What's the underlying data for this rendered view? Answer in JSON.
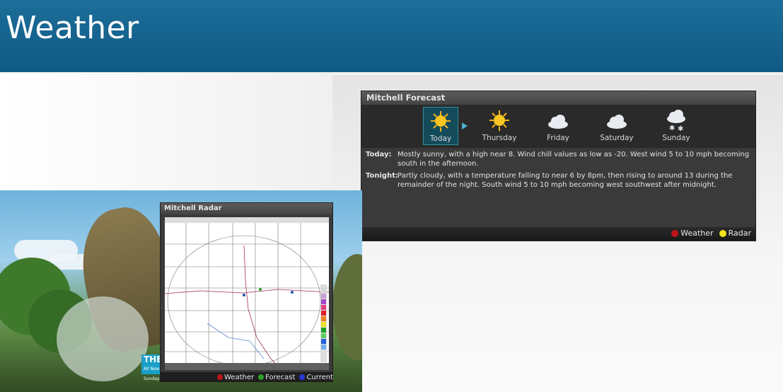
{
  "header": {
    "title": "Weather"
  },
  "forecast": {
    "title": "Mitchell Forecast",
    "days": [
      {
        "label": "Today",
        "icon": "sun-icon",
        "selected": true
      },
      {
        "label": "Thursday",
        "icon": "sun-icon"
      },
      {
        "label": "Friday",
        "icon": "cloud-icon"
      },
      {
        "label": "Saturday",
        "icon": "cloud-icon"
      },
      {
        "label": "Sunday",
        "icon": "snow-cloud-icon"
      }
    ],
    "today_key": "Today:",
    "today_text": "Mostly sunny, with a high near 8. Wind chill values as low as -20. West wind 5 to 10 mph becoming south in the afternoon.",
    "tonight_key": "Tonight:",
    "tonight_text": "Partly cloudy, with a temperature falling to near 6 by 8pm, then rising to around 13 during the remainder of the night. South wind 5 to 10 mph becoming west southwest after midnight.",
    "legend": [
      {
        "label": "Weather",
        "color": "#c0141a"
      },
      {
        "label": "Radar",
        "color": "#f4e21a"
      }
    ]
  },
  "radar": {
    "title": "Mitchell Radar",
    "legend": [
      {
        "label": "Weather",
        "color": "#c0141a"
      },
      {
        "label": "Forecast",
        "color": "#2aa02a"
      },
      {
        "label": "Current",
        "color": "#2a3ad8"
      }
    ]
  },
  "video": {
    "badge": "THE",
    "badge_sub": "All New Sunday"
  },
  "colors": {
    "header": "#15628e",
    "selected_day": "#144b5a"
  }
}
